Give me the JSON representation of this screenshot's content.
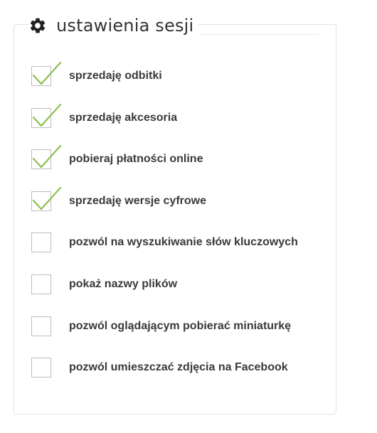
{
  "settings": {
    "title": "ustawienia sesji",
    "icon": "gear-icon",
    "check_color": "#8cc152",
    "options": [
      {
        "label": "sprzedaję odbitki",
        "checked": true
      },
      {
        "label": "sprzedaję akcesoria",
        "checked": true
      },
      {
        "label": "pobieraj płatności online",
        "checked": true
      },
      {
        "label": "sprzedaję wersje cyfrowe",
        "checked": true
      },
      {
        "label": "pozwól na wyszukiwanie słów kluczowych",
        "checked": false
      },
      {
        "label": "pokaż nazwy plików",
        "checked": false
      },
      {
        "label": "pozwól oglądającym pobierać miniaturkę",
        "checked": false
      },
      {
        "label": "pozwól umieszczać zdjęcia na Facebook",
        "checked": false
      }
    ]
  }
}
